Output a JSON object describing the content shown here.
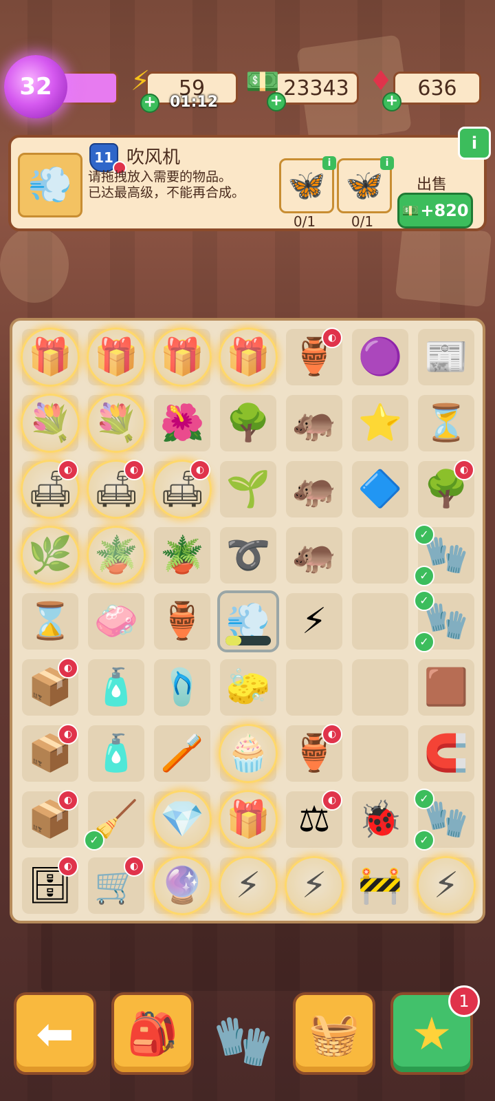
{
  "hud": {
    "level": "32",
    "energy": "59",
    "energy_timer": "01:12",
    "cash": "23343",
    "gems": "636"
  },
  "info": {
    "item_level": "11",
    "item_name": "吹风机",
    "desc_line1": "请拖拽放入需要的物品。",
    "desc_line2": "已达最高级，不能再合成。",
    "req1_count": "0/1",
    "req2_count": "0/1",
    "sell_label": "出售",
    "sell_value": "+820"
  },
  "board": {
    "cells": [
      [
        "gift-bubble",
        "gift-bubble",
        "gift-bubble",
        "gift-bubble",
        "vase-locked",
        "purple-blob",
        "newspaper"
      ],
      [
        "flowerpot-bubble",
        "flowerpot-bubble",
        "flowerbed",
        "bonsai",
        "hippo-statue",
        "purple-star",
        "hourglass-gem"
      ],
      [
        "sofa-bubble-locked",
        "sofa-bubble-locked",
        "sofa-bubble-locked",
        "sprout",
        "hippo-fountain",
        "purple-gem",
        "tree-locked"
      ],
      [
        "plant-bubble",
        "pot-bubble",
        "clay-pot",
        "rings",
        "hippo-pond",
        "empty",
        "glove-check"
      ],
      [
        "hourglass",
        "soap",
        "clay-shard",
        "hairdryer-selected",
        "energy-orb",
        "empty",
        "glove-check"
      ],
      [
        "box-locked",
        "lotion",
        "slippers",
        "sponge",
        "empty",
        "empty",
        "mat"
      ],
      [
        "box-locked",
        "lotion-big",
        "brush",
        "bubble-mixer",
        "vase-locked",
        "empty",
        "horseshoe"
      ],
      [
        "crate-locked",
        "broom-check",
        "bubble-gem",
        "bubble-gift",
        "scale-locked",
        "ladybug",
        "glove-check"
      ],
      [
        "cabinet-locked",
        "cart-locked",
        "bubble-crystal",
        "bubble-energy",
        "bubble-energy",
        "barrier",
        "bubble-energy"
      ]
    ],
    "dryer_progress": 0.35
  },
  "bottom": {
    "star_badge": "1"
  },
  "colors": {
    "accent_green": "#3cbd5c",
    "accent_orange": "#f9b93e",
    "panel": "#fbe7c8",
    "border_brown": "#8c4b2a"
  }
}
